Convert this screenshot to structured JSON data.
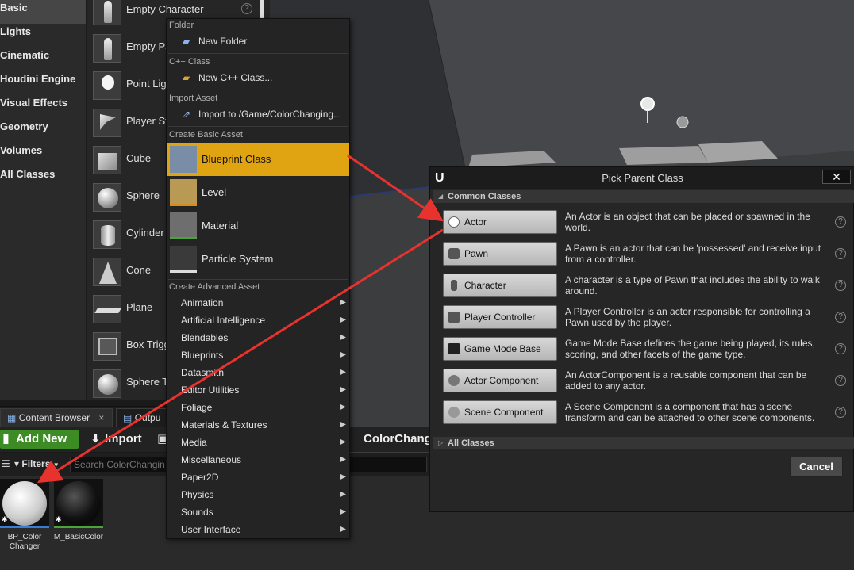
{
  "categories": [
    "Basic",
    "Lights",
    "Cinematic",
    "Houdini Engine",
    "Visual Effects",
    "Geometry",
    "Volumes",
    "All Classes"
  ],
  "place_items": [
    {
      "label": "Empty Character",
      "shape": "figure"
    },
    {
      "label": "Empty Pa",
      "shape": "figure"
    },
    {
      "label": "Point Ligh",
      "shape": "bulb"
    },
    {
      "label": "Player St",
      "shape": "flag"
    },
    {
      "label": "Cube",
      "shape": "cube"
    },
    {
      "label": "Sphere",
      "shape": "sphere"
    },
    {
      "label": "Cylinder",
      "shape": "cyl"
    },
    {
      "label": "Cone",
      "shape": "cone"
    },
    {
      "label": "Plane",
      "shape": "plane"
    },
    {
      "label": "Box Trigg",
      "shape": "box"
    },
    {
      "label": "Sphere T",
      "shape": "sphere"
    }
  ],
  "content_browser": {
    "tabs": [
      "Content Browser",
      "Outpu"
    ],
    "tab_close": "×",
    "add_new": "Add New",
    "import": "Import",
    "path": "ColorChangi",
    "filters": "Filters",
    "search_placeholder": "Search ColorChangin",
    "assets": [
      {
        "label_line1": "BP_Color",
        "label_line2": "Changer"
      },
      {
        "label_line1": "M_BasicColor",
        "label_line2": ""
      }
    ]
  },
  "context_menu": {
    "folder_header": "Folder",
    "new_folder": "New Folder",
    "cpp_header": "C++ Class",
    "new_cpp": "New C++ Class...",
    "import_header": "Import Asset",
    "import_to": "Import to /Game/ColorChanging...",
    "basic_header": "Create Basic Asset",
    "basic_assets": [
      "Blueprint Class",
      "Level",
      "Material",
      "Particle System"
    ],
    "advanced_header": "Create Advanced Asset",
    "advanced_items": [
      "Animation",
      "Artificial Intelligence",
      "Blendables",
      "Blueprints",
      "Datasmith",
      "Editor Utilities",
      "Foliage",
      "Materials & Textures",
      "Media",
      "Miscellaneous",
      "Paper2D",
      "Physics",
      "Sounds",
      "User Interface"
    ],
    "submenu_arrow": "▶"
  },
  "dialog": {
    "title": "Pick Parent Class",
    "logo": "U",
    "close": "✕",
    "common_header": "Common Classes",
    "all_header": "All Classes",
    "cancel": "Cancel",
    "classes": [
      {
        "name": "Actor",
        "desc": "An Actor is an object that can be placed or spawned in the world."
      },
      {
        "name": "Pawn",
        "desc": "A Pawn is an actor that can be 'possessed' and receive input from a controller."
      },
      {
        "name": "Character",
        "desc": "A character is a type of Pawn that includes the ability to walk around."
      },
      {
        "name": "Player Controller",
        "desc": "A Player Controller is an actor responsible for controlling a Pawn used by the player."
      },
      {
        "name": "Game Mode Base",
        "desc": "Game Mode Base defines the game being played, its rules, scoring, and other facets of the game type."
      },
      {
        "name": "Actor Component",
        "desc": "An ActorComponent is a reusable component that can be added to any actor."
      },
      {
        "name": "Scene Component",
        "desc": "A Scene Component is a component that has a scene transform and can be attached to other scene components."
      }
    ]
  },
  "help_glyph": "?",
  "accent_color": "#e0a412",
  "annotation_color": "#e8322e"
}
